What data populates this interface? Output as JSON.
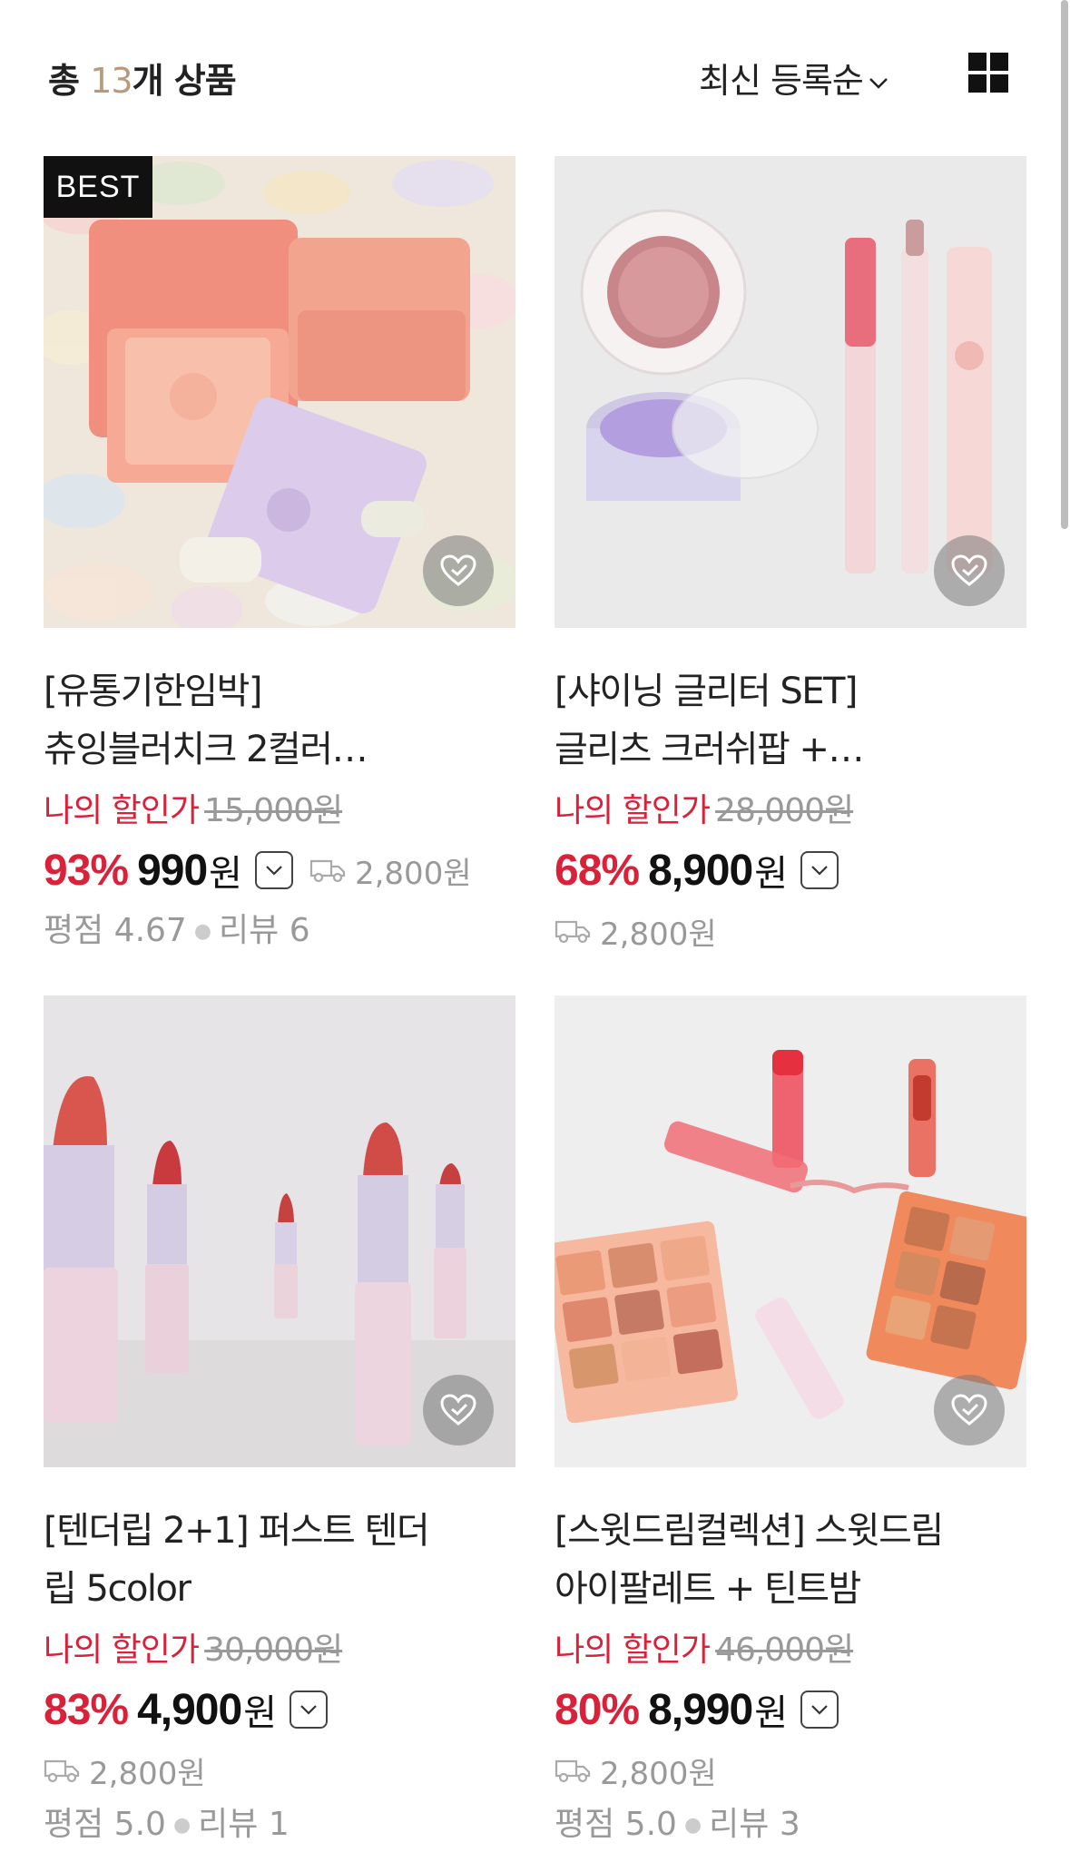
{
  "header": {
    "count_prefix": "총 ",
    "count_num": "13",
    "count_suffix": "개 상품",
    "sort_label": "최신 등록순"
  },
  "products": [
    {
      "badge": "BEST",
      "title_line1": "[유통기한임박]",
      "title_line2": "츄잉블러치크 2컬러…",
      "discount_label": "나의 할인가",
      "original_price": "15,000원",
      "discount_rate": "93%",
      "price": "990",
      "currency": "원",
      "shipping": "2,800원",
      "rating_label": "평점 4.67",
      "review_label": "리뷰 6"
    },
    {
      "badge": "",
      "title_line1": "[샤이닝 글리터 SET]",
      "title_line2": "글리츠 크러쉬팝 +…",
      "discount_label": "나의 할인가",
      "original_price": "28,000원",
      "discount_rate": "68%",
      "price": "8,900",
      "currency": "원",
      "shipping": "2,800원",
      "rating_label": "",
      "review_label": ""
    },
    {
      "badge": "",
      "title_line1": "[텐더립 2+1] 퍼스트 텐더",
      "title_line2": "립 5color",
      "discount_label": "나의 할인가",
      "original_price": "30,000원",
      "discount_rate": "83%",
      "price": "4,900",
      "currency": "원",
      "shipping": "2,800원",
      "rating_label": "평점 5.0",
      "review_label": "리뷰 1"
    },
    {
      "badge": "",
      "title_line1": "[스윗드림컬렉션] 스윗드림",
      "title_line2": "아이팔레트 + 틴트밤",
      "discount_label": "나의 할인가",
      "original_price": "46,000원",
      "discount_rate": "80%",
      "price": "8,990",
      "currency": "원",
      "shipping": "2,800원",
      "rating_label": "평점 5.0",
      "review_label": "리뷰 3"
    }
  ],
  "colors": {
    "accent_red": "#d9223a",
    "count_gold": "#b99a7a"
  },
  "icons": [
    "chevron-down-icon",
    "grid-view-icon",
    "wishlist-heart-icon",
    "truck-icon"
  ]
}
